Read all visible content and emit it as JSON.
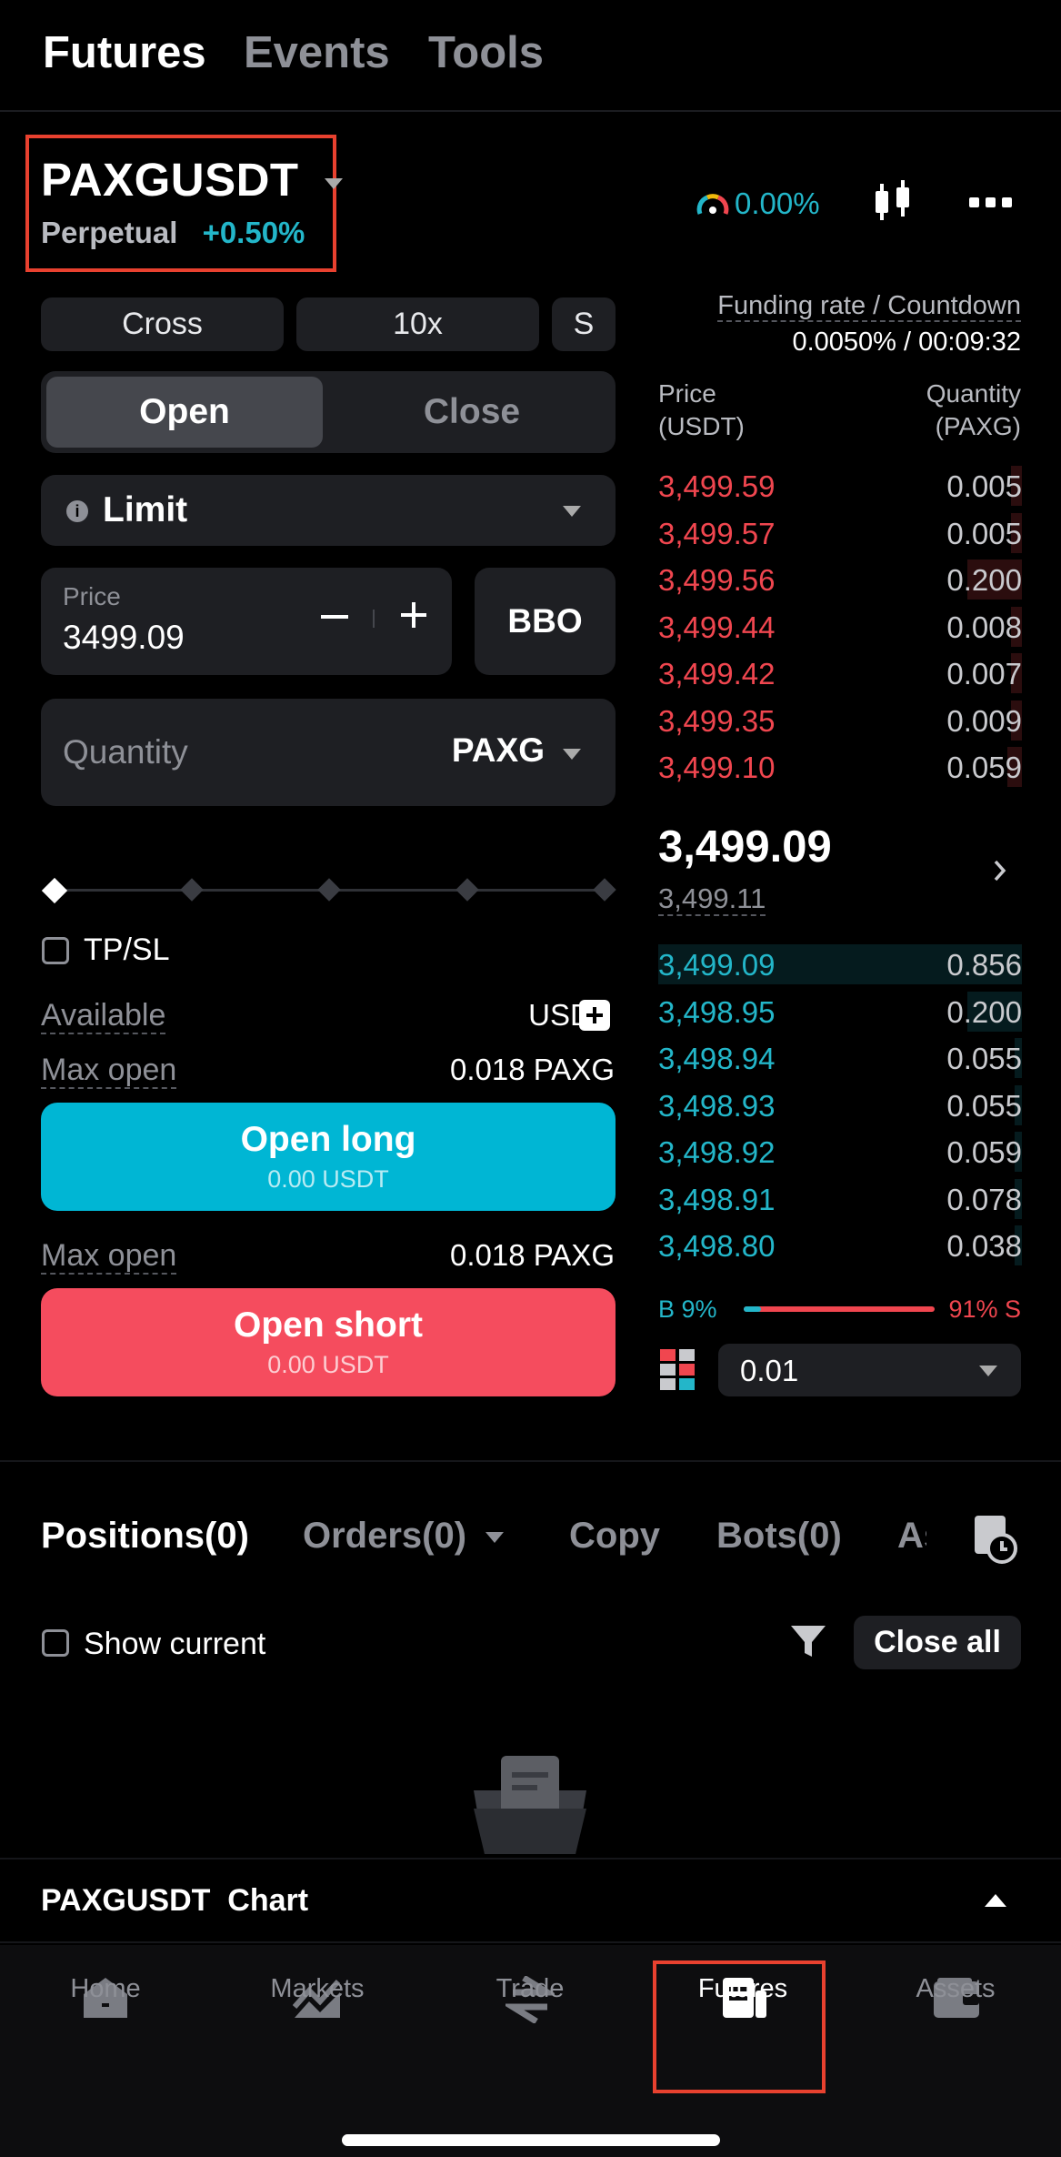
{
  "top_tabs": [
    "Futures",
    "Events",
    "Tools"
  ],
  "symbol": {
    "name": "PAXGUSDT",
    "type": "Perpetual",
    "change": "+0.50%"
  },
  "sentiment": {
    "value": "0.00%"
  },
  "controls": {
    "margin_mode": "Cross",
    "leverage": "10x",
    "mode_short": "S"
  },
  "funding": {
    "label": "Funding rate / Countdown",
    "value": "0.0050% / 00:09:32"
  },
  "order_form": {
    "open_tab": "Open",
    "close_tab": "Close",
    "order_type": "Limit",
    "price_label": "Price",
    "price_value": "3499.09",
    "bbo_label": "BBO",
    "quantity_placeholder": "Quantity",
    "quantity_unit": "PAXG",
    "tpsl_label": "TP/SL",
    "available_label": "Available",
    "available_value": "USDT",
    "max_open_label": "Max open",
    "max_open_long": "0.018 PAXG",
    "max_open_short": "0.018 PAXG",
    "open_long_label": "Open long",
    "open_long_sub": "0.00 USDT",
    "open_short_label": "Open short",
    "open_short_sub": "0.00 USDT",
    "slider_percent": 0
  },
  "orderbook": {
    "price_header": "Price",
    "price_unit": "(USDT)",
    "qty_header": "Quantity",
    "qty_unit": "(PAXG)",
    "asks": [
      {
        "price": "3,499.59",
        "qty": "0.005",
        "depth": 0.03
      },
      {
        "price": "3,499.57",
        "qty": "0.005",
        "depth": 0.03
      },
      {
        "price": "3,499.56",
        "qty": "0.200",
        "depth": 0.15
      },
      {
        "price": "3,499.44",
        "qty": "0.008",
        "depth": 0.03
      },
      {
        "price": "3,499.42",
        "qty": "0.007",
        "depth": 0.03
      },
      {
        "price": "3,499.35",
        "qty": "0.009",
        "depth": 0.03
      },
      {
        "price": "3,499.10",
        "qty": "0.059",
        "depth": 0.04
      }
    ],
    "last_price": "3,499.09",
    "mark_price": "3,499.11",
    "bids": [
      {
        "price": "3,499.09",
        "qty": "0.856",
        "depth": 1.0
      },
      {
        "price": "3,498.95",
        "qty": "0.200",
        "depth": 0.15
      },
      {
        "price": "3,498.94",
        "qty": "0.055",
        "depth": 0.02
      },
      {
        "price": "3,498.93",
        "qty": "0.055",
        "depth": 0.02
      },
      {
        "price": "3,498.92",
        "qty": "0.059",
        "depth": 0.02
      },
      {
        "price": "3,498.91",
        "qty": "0.078",
        "depth": 0.02
      },
      {
        "price": "3,498.80",
        "qty": "0.038",
        "depth": 0.02
      }
    ],
    "buy_ratio": "B 9%",
    "sell_ratio": "91% S",
    "buy_fraction": 0.09,
    "precision": "0.01"
  },
  "positions_tabs": {
    "positions": "Positions(0)",
    "orders": "Orders(0)",
    "copy": "Copy",
    "bots": "Bots(0)",
    "assets_cut": "As"
  },
  "positions": {
    "show_current": "Show current",
    "close_all": "Close all"
  },
  "chart_bar": {
    "label": "PAXGUSDT  Chart"
  },
  "nav": [
    "Home",
    "Markets",
    "Trade",
    "Futures",
    "Assets"
  ],
  "colors": {
    "buy": "#23b6c9",
    "sell": "#f0464f",
    "long_btn": "#00b6d4",
    "short_btn": "#f54c5e",
    "highlight": "#e8412f"
  }
}
